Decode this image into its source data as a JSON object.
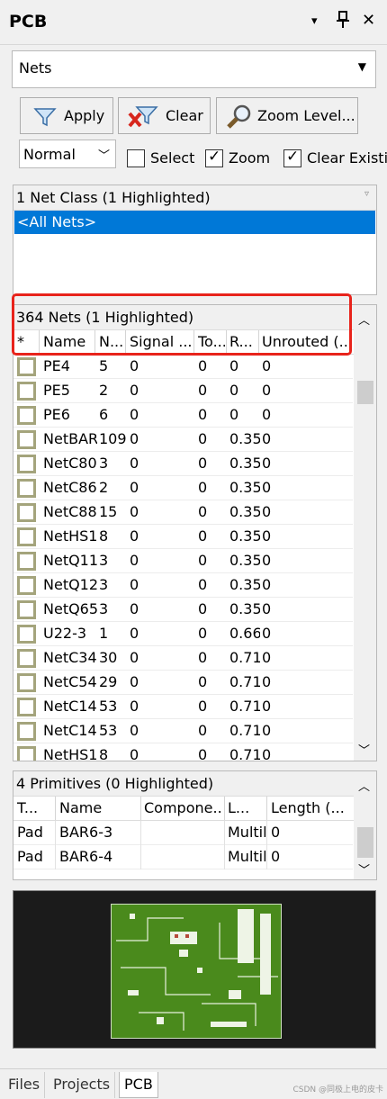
{
  "panel": {
    "title": "PCB",
    "controls": {
      "dropdown": "▾",
      "pin": "📌",
      "close": "✕"
    }
  },
  "mode_dropdown": {
    "value": "Nets"
  },
  "toolbar": {
    "apply": "Apply",
    "clear": "Clear",
    "zoom_level": "Zoom Level..."
  },
  "options": {
    "mask_mode": "Normal",
    "select": {
      "label": "Select",
      "checked": false
    },
    "zoom": {
      "label": "Zoom",
      "checked": true
    },
    "clear_existing": {
      "label": "Clear Existin",
      "checked": true
    }
  },
  "net_classes": {
    "header": "1 Net Class (1 Highlighted)",
    "items": [
      "<All Nets>"
    ]
  },
  "nets": {
    "header": "364 Nets (1 Highlighted)",
    "columns": [
      "*",
      "Name",
      "N...",
      "Signal ...",
      "To...",
      "R...",
      "Unrouted (..."
    ],
    "rows": [
      [
        "PE4",
        "5",
        "0",
        "0",
        "0",
        "0"
      ],
      [
        "PE5",
        "2",
        "0",
        "0",
        "0",
        "0"
      ],
      [
        "PE6",
        "6",
        "0",
        "0",
        "0",
        "0"
      ],
      [
        "NetBAR",
        "109",
        "0",
        "0",
        "0.35",
        "0"
      ],
      [
        "NetC80",
        "3",
        "0",
        "0",
        "0.35",
        "0"
      ],
      [
        "NetC86",
        "2",
        "0",
        "0",
        "0.35",
        "0"
      ],
      [
        "NetC88",
        "15",
        "0",
        "0",
        "0.35",
        "0"
      ],
      [
        "NetHS1",
        "8",
        "0",
        "0",
        "0.35",
        "0"
      ],
      [
        "NetQ11",
        "3",
        "0",
        "0",
        "0.35",
        "0"
      ],
      [
        "NetQ12",
        "3",
        "0",
        "0",
        "0.35",
        "0"
      ],
      [
        "NetQ65",
        "3",
        "0",
        "0",
        "0.35",
        "0"
      ],
      [
        "U22-3",
        "1",
        "0",
        "0",
        "0.66",
        "0"
      ],
      [
        "NetC34",
        "30",
        "0",
        "0",
        "0.71",
        "0"
      ],
      [
        "NetC54",
        "29",
        "0",
        "0",
        "0.71",
        "0"
      ],
      [
        "NetC14",
        "53",
        "0",
        "0",
        "0.71",
        "0"
      ],
      [
        "NetC14",
        "53",
        "0",
        "0",
        "0.71",
        "0"
      ],
      [
        "NetHS1",
        "8",
        "0",
        "0",
        "0.71",
        "0"
      ]
    ]
  },
  "primitives": {
    "header": "4 Primitives (0 Highlighted)",
    "columns": [
      "T...",
      "Name",
      "Compone...",
      "L...",
      "Length (..."
    ],
    "rows": [
      [
        "Pad",
        "BAR6-3",
        "",
        "Multil",
        "0"
      ],
      [
        "Pad",
        "BAR6-4",
        "",
        "Multil",
        "0"
      ]
    ]
  },
  "tabs": [
    "Files",
    "Projects",
    "PCB"
  ],
  "active_tab": "PCB",
  "watermark": "CSDN @同极上电的皮卡",
  "colors": {
    "selection": "#0078d7",
    "highlight_outline": "#e8231b",
    "board_green": "#4a8a1c",
    "net_swatch": "#a4a47c"
  }
}
